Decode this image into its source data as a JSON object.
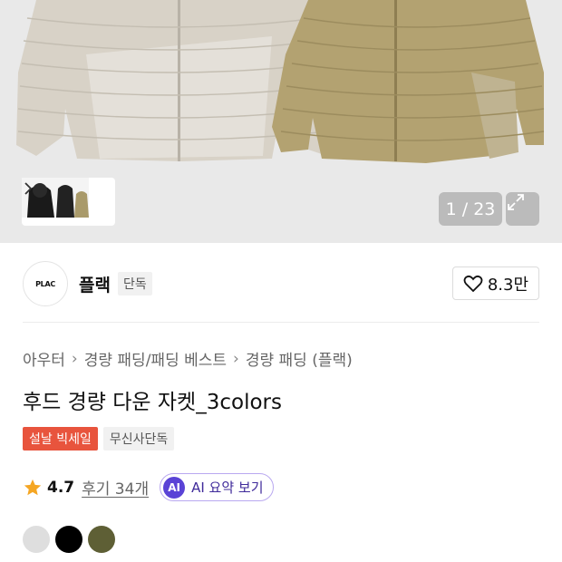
{
  "gallery": {
    "counter": "1 / 23",
    "thumbnail_icon": "product-thumbnail-strip",
    "next_icon": "chevron-right-icon",
    "expand_icon": "expand-icon"
  },
  "brand": {
    "logo_text": "PLAC",
    "name": "플랙",
    "badge": "단독",
    "like_count": "8.3만"
  },
  "breadcrumb": [
    "아우터",
    "경량 패딩/패딩 베스트",
    "경량 패딩 (플랙)"
  ],
  "product": {
    "title": "후드 경량 다운 자켓_3colors",
    "tags": {
      "sale": "설날 빅세일",
      "exclusive": "무신사단독"
    },
    "rating": "4.7",
    "reviews": "후기 34개",
    "ai_badge": "AI",
    "ai_summary": "AI 요약 보기"
  },
  "colors": {
    "accent_sale": "#e8543d",
    "accent_ai": "#5a43d6",
    "star": "#f5a623",
    "swatches": [
      "#dedede",
      "#000000",
      "#5e5f35"
    ]
  }
}
